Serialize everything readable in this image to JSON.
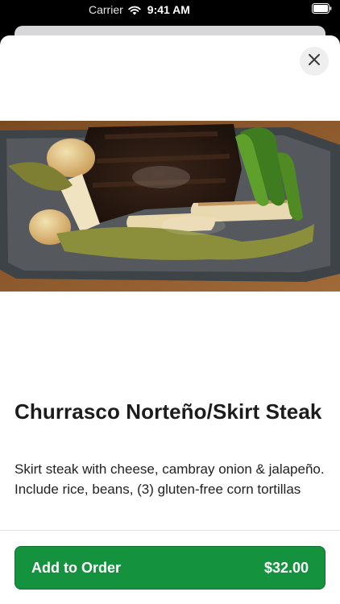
{
  "status_bar": {
    "carrier": "Carrier",
    "time": "9:41 AM",
    "wifi_icon": "wifi-icon",
    "battery_icon": "battery-icon"
  },
  "sheet": {
    "close_icon": "close-icon",
    "image_icon": "food-photo"
  },
  "item": {
    "title": "Churrasco Norteño/Skirt Steak",
    "description": "Skirt steak with cheese, cambray onion & jalapeño. Include rice, beans, (3) gluten-free corn tortillas"
  },
  "order_button": {
    "label": "Add to Order",
    "price": "$32.00",
    "color": "#14923e"
  }
}
